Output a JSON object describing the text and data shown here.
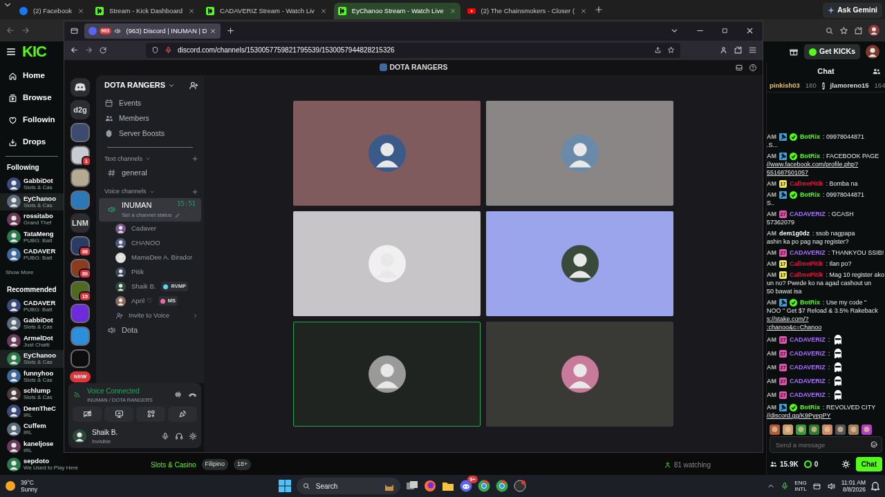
{
  "browser_tabs": [
    {
      "title": "(2) Facebook",
      "kind": "facebook",
      "selected": false
    },
    {
      "title": "Stream - Kick Dashboard",
      "kind": "kick",
      "selected": false
    },
    {
      "title": "CADAVERIZ Stream - Watch Liv",
      "kind": "kick",
      "selected": false
    },
    {
      "title": "EyChanoo Stream - Watch Live",
      "kind": "kick",
      "selected": true
    },
    {
      "title": "(2) The Chainsmokers - Closer (",
      "kind": "youtube",
      "selected": false
    }
  ],
  "gemini_button": "Ask Gemini",
  "kick": {
    "logo": "KIC",
    "get_kicks": "Get KICKs",
    "nav": [
      {
        "label": "Home"
      },
      {
        "label": "Browse"
      },
      {
        "label": "Followin"
      },
      {
        "label": "Drops"
      }
    ],
    "following_heading": "Following",
    "following": [
      {
        "name": "GabbiDot",
        "category": "Slots & Cas",
        "selected": false
      },
      {
        "name": "EyChanoo",
        "category": "Slots & Cas",
        "selected": true
      },
      {
        "name": "rossitabo",
        "category": "Grand Thef",
        "selected": false
      },
      {
        "name": "TataMeng",
        "category": "PUBG: Batt",
        "selected": false
      },
      {
        "name": "CADAVER",
        "category": "PUBG: Batt",
        "selected": false
      }
    ],
    "show_more": "Show More",
    "recommended_heading": "Recommended",
    "recommended": [
      {
        "name": "CADAVER",
        "category": "PUBG: Batt",
        "selected": false
      },
      {
        "name": "GabbiDot",
        "category": "Slots & Cas",
        "selected": false
      },
      {
        "name": "ArmelDot",
        "category": "Just Chatti",
        "selected": false
      },
      {
        "name": "EyChanoo",
        "category": "Slots & Cas",
        "selected": true
      },
      {
        "name": "funnyhoo",
        "category": "Slots & Cas",
        "selected": false
      },
      {
        "name": "schlump",
        "category": "Slots & Cas",
        "selected": false
      },
      {
        "name": "DeenTheC",
        "category": "IRL",
        "selected": false
      },
      {
        "name": "Cuffem",
        "category": "IRL",
        "selected": false
      },
      {
        "name": "kaneljose",
        "category": "IRL",
        "selected": false
      },
      {
        "name": "sepdoto",
        "category": "We Used to Play Here",
        "selected": false
      }
    ],
    "stream_info": {
      "category": "Slots & Casino",
      "tags": [
        "Filipino",
        "18+"
      ],
      "viewers": "81 watching"
    },
    "chat": {
      "title": "Chat",
      "gifters": [
        {
          "name": "pinkish03",
          "count": "180"
        },
        {
          "name": "jlamoreno15",
          "count": "164",
          "rank": "2"
        }
      ],
      "messages": [
        {
          "time": "AM",
          "user": "BotRix",
          "color": "#53fc18",
          "badges": [
            {
              "kind": "bot"
            },
            {
              "kind": "verified"
            }
          ],
          "lines": [
            {
              "text": ": 09978044871",
              "link": false
            },
            {
              "text": ".S...",
              "link": false
            }
          ]
        },
        {
          "time": "AM",
          "user": "BotRix",
          "color": "#53fc18",
          "badges": [
            {
              "kind": "bot"
            },
            {
              "kind": "verified"
            }
          ],
          "lines": [
            {
              "text": ": FACEBOOK PAGE",
              "link": false
            },
            {
              "text": "//www.facebook.com/profile.php?",
              "link": true
            },
            {
              "text": "551687501057",
              "link": true
            }
          ]
        },
        {
          "time": "AM",
          "user": "CallmePitik",
          "color": "#e9113c",
          "badges": [
            {
              "kind": "sub",
              "label": "17",
              "color": "#f2e94e"
            }
          ],
          "lines": [
            {
              "text": ": Bomba na",
              "link": false
            }
          ]
        },
        {
          "time": "AM",
          "user": "BotRix",
          "color": "#53fc18",
          "badges": [
            {
              "kind": "bot"
            },
            {
              "kind": "verified"
            }
          ],
          "lines": [
            {
              "text": ": 09978044871",
              "link": false
            },
            {
              "text": "S..",
              "link": false
            }
          ]
        },
        {
          "time": "AM",
          "user": "CADAVERIZ",
          "color": "#a970ff",
          "badges": [
            {
              "kind": "sub",
              "label": "27",
              "color": "#e74fb0"
            }
          ],
          "lines": [
            {
              "text": ": GCASH",
              "link": false
            },
            {
              "text": "57362079",
              "link": false
            }
          ]
        },
        {
          "time": "AM",
          "user": "dem1g0dz",
          "color": "#ffffff",
          "lines": [
            {
              "text": ": ssob nagpapa",
              "link": false
            },
            {
              "text": "ashin ka po pag nag register?",
              "link": false
            }
          ]
        },
        {
          "time": "AM",
          "user": "CADAVERIZ",
          "color": "#a970ff",
          "badges": [
            {
              "kind": "sub",
              "label": "27",
              "color": "#e74fb0"
            }
          ],
          "lines": [
            {
              "text": ": THANKYOU SSIB!",
              "link": false
            }
          ]
        },
        {
          "time": "AM",
          "user": "CallmePitik",
          "color": "#e9113c",
          "badges": [
            {
              "kind": "sub",
              "label": "17",
              "color": "#f2e94e"
            }
          ],
          "lines": [
            {
              "text": ": Ilan po?",
              "link": false
            }
          ]
        },
        {
          "time": "AM",
          "user": "CallmePitik",
          "color": "#e9113c",
          "badges": [
            {
              "kind": "sub",
              "label": "17",
              "color": "#f2e94e"
            }
          ],
          "lines": [
            {
              "text": ": Mag 10 register ako",
              "link": false
            },
            {
              "text": "un no? Pwede ko na agad cashout un",
              "link": false
            },
            {
              "text": "50 bawat isa",
              "link": false
            }
          ]
        },
        {
          "time": "AM",
          "user": "BotRix",
          "color": "#53fc18",
          "badges": [
            {
              "kind": "bot"
            },
            {
              "kind": "verified"
            }
          ],
          "lines": [
            {
              "text": ": Use my code \"",
              "link": false
            },
            {
              "text": "NOO \" Get $7 Reload & 3.5% Rakeback",
              "link": false
            },
            {
              "text": "s://stake.com/?",
              "link": true
            },
            {
              "text": ":chanoo&c=Chanoo",
              "link": true
            }
          ]
        },
        {
          "time": "AM",
          "user": "CADAVERIZ",
          "color": "#a970ff",
          "badges": [
            {
              "kind": "sub",
              "label": "27",
              "color": "#e74fb0"
            }
          ],
          "lines": [
            {
              "text": ":",
              "link": false
            }
          ],
          "emote": true
        },
        {
          "time": "AM",
          "user": "CADAVERIZ",
          "color": "#a970ff",
          "badges": [
            {
              "kind": "sub",
              "label": "27",
              "color": "#e74fb0"
            }
          ],
          "lines": [
            {
              "text": ":",
              "link": false
            }
          ],
          "emote": true
        },
        {
          "time": "AM",
          "user": "CADAVERIZ",
          "color": "#a970ff",
          "badges": [
            {
              "kind": "sub",
              "label": "27",
              "color": "#e74fb0"
            }
          ],
          "lines": [
            {
              "text": ":",
              "link": false
            }
          ],
          "emote": true
        },
        {
          "time": "AM",
          "user": "CADAVERIZ",
          "color": "#a970ff",
          "badges": [
            {
              "kind": "sub",
              "label": "27",
              "color": "#e74fb0"
            }
          ],
          "lines": [
            {
              "text": ":",
              "link": false
            }
          ],
          "emote": true
        },
        {
          "time": "AM",
          "user": "CADAVERIZ",
          "color": "#a970ff",
          "badges": [
            {
              "kind": "sub",
              "label": "27",
              "color": "#e74fb0"
            }
          ],
          "lines": [
            {
              "text": ":",
              "link": false
            }
          ],
          "emote": true
        },
        {
          "time": "AM",
          "user": "BotRix",
          "color": "#53fc18",
          "badges": [
            {
              "kind": "bot"
            },
            {
              "kind": "verified"
            }
          ],
          "lines": [
            {
              "text": ": REVOLVED CITY",
              "link": false
            },
            {
              "text": "//discord.gg/K9PyepPY",
              "link": true
            }
          ]
        }
      ],
      "placeholder": "Send a message",
      "followers": "15.9K",
      "points": "0",
      "send_button": "Chat"
    }
  },
  "discord_window": {
    "tab_title": "(963) Discord | INUMAN | D",
    "tab_badge": "963",
    "url": "discord.com/channels/1530057759821795539/1530057944828215326",
    "title": "DOTA RANGERS",
    "servers": [
      {
        "kind": "home"
      },
      {
        "kind": "text",
        "label": "d2g"
      },
      {
        "kind": "image",
        "color": "#3d4a70"
      },
      {
        "kind": "image",
        "color": "#c9ccd2",
        "badge": "1"
      },
      {
        "kind": "image",
        "color": "#b5a98f"
      },
      {
        "kind": "image",
        "color": "#2b79b8"
      },
      {
        "kind": "text",
        "label": "LNM"
      },
      {
        "kind": "image",
        "color": "#2c3a66",
        "badge": "88"
      },
      {
        "kind": "image",
        "color": "#8c3b1c",
        "badge": "80"
      },
      {
        "kind": "image",
        "color": "#4f6a1e",
        "badge": "15"
      },
      {
        "kind": "image",
        "color": "#6d2bdc"
      },
      {
        "kind": "image",
        "color": "#2a8fdc"
      },
      {
        "kind": "image",
        "color": "#0d0d0d"
      }
    ],
    "server_new": "NEW",
    "server_name": "DOTA RANGERS",
    "menu": [
      {
        "label": "Events"
      },
      {
        "label": "Members"
      },
      {
        "label": "Server Boosts"
      }
    ],
    "text_heading": "Text channels",
    "text_channels": [
      {
        "name": "general"
      }
    ],
    "voice_heading": "Voice channels",
    "voice_channels": [
      {
        "name": "INUMAN",
        "selected": true,
        "timer": "15:51",
        "status": "Set a channel status",
        "members": [
          {
            "name": "Cadaver"
          },
          {
            "name": "CHANOO"
          },
          {
            "name": "MamaDee A. Birador"
          },
          {
            "name": "Pitik"
          },
          {
            "name": "Shaik B.",
            "tag": "RVMP"
          },
          {
            "name": "April ♡",
            "tag": "MS"
          }
        ],
        "invite": "Invite to Voice"
      },
      {
        "name": "Dota",
        "selected": false
      }
    ],
    "voice_panel": {
      "status": "Voice Connected",
      "location": "INUMAN / DOTA RANGERS"
    },
    "user": {
      "name": "Shaik B.",
      "status": "Invisible"
    },
    "tiles": [
      {
        "color": "#7f5b5e",
        "speaking": false
      },
      {
        "color": "#8b8686",
        "speaking": false
      },
      {
        "color": "#c7c5c7",
        "speaking": false
      },
      {
        "color": "#9aa5ec",
        "speaking": false
      },
      {
        "color": "#1f2421",
        "speaking": true
      },
      {
        "color": "#393936",
        "speaking": false
      }
    ]
  },
  "taskbar": {
    "temperature": "39°C",
    "weather": "Sunny",
    "search": "Search",
    "discord_badge": "9+",
    "lang": "ENG",
    "layout": "INTL",
    "time": "11:01 AM",
    "date": "8/8/2026"
  }
}
